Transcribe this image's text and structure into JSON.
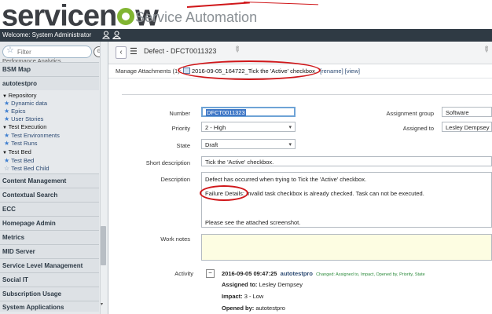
{
  "brand": {
    "logo_text_1": "service",
    "logo_text_2": "n",
    "logo_text_3": "w",
    "trademark": "™",
    "product": "Service Automation"
  },
  "welcome": {
    "text": "Welcome: System Administrator"
  },
  "nav": {
    "filter_placeholder": "Filter",
    "partial_top": "Performance Analytics",
    "sections_top": [
      "BSM Map",
      "autotestpro"
    ],
    "items": [
      {
        "label": "Repository",
        "type": "header"
      },
      {
        "label": "Dynamic data",
        "type": "star"
      },
      {
        "label": "Epics",
        "type": "star"
      },
      {
        "label": "User Stories",
        "type": "star"
      },
      {
        "label": "Test Execution",
        "type": "header"
      },
      {
        "label": "Test Environments",
        "type": "star"
      },
      {
        "label": "Test Runs",
        "type": "star"
      },
      {
        "label": "Test Bed",
        "type": "header"
      },
      {
        "label": "Test Bed",
        "type": "star"
      },
      {
        "label": "Test Bed Child",
        "type": "star-outline"
      }
    ],
    "sections_bottom": [
      "Content Management",
      "Contextual Search",
      "ECC",
      "Homepage Admin",
      "Metrics",
      "MID Server",
      "Service Level Management",
      "Social IT",
      "Subscription Usage",
      "System Applications"
    ]
  },
  "record": {
    "title": "Defect - DFCT0011323",
    "attachments_label": "Manage Attachments (1):",
    "attachment_name": "2016-09-05_164722_Tick the 'Active' checkbox.",
    "rename_label": "[rename]",
    "view_label": "[view]"
  },
  "form": {
    "number_label": "Number",
    "number_value": "DFCT0011323",
    "priority_label": "Priority",
    "priority_value": "2 - High",
    "state_label": "State",
    "state_value": "Draft",
    "short_desc_label": "Short description",
    "short_desc_value": "Tick the 'Active' checkbox.",
    "description_label": "Description",
    "description_line1": "Defect has occurred when trying to Tick the 'Active' checkbox.",
    "description_line2a": "Failure Details:",
    "description_line2b": " Invalid task checkbox is already checked. Task can not be executed.",
    "description_line3": "Please see the attached screenshot.",
    "assignment_group_label": "Assignment group",
    "assignment_group_value": "Software",
    "assigned_to_label": "Assigned to",
    "assigned_to_value": "Lesley Dempsey",
    "work_notes_label": "Work notes",
    "activity_label": "Activity"
  },
  "activity": {
    "timestamp": "2016-09-05 09:47:25",
    "user": "autotestpro",
    "changed": "Changed: Assigned to, Impact, Opened by, Priority, State",
    "rows": [
      {
        "label": "Assigned to:",
        "value": " Lesley Dempsey"
      },
      {
        "label": "Impact:",
        "value": " 3 - Low"
      },
      {
        "label": "Opened by:",
        "value": " autotestpro"
      }
    ]
  },
  "colors": {
    "brand_green": "#81b532",
    "header_dark": "#2f3a44",
    "annotation_red": "#d0171a"
  }
}
